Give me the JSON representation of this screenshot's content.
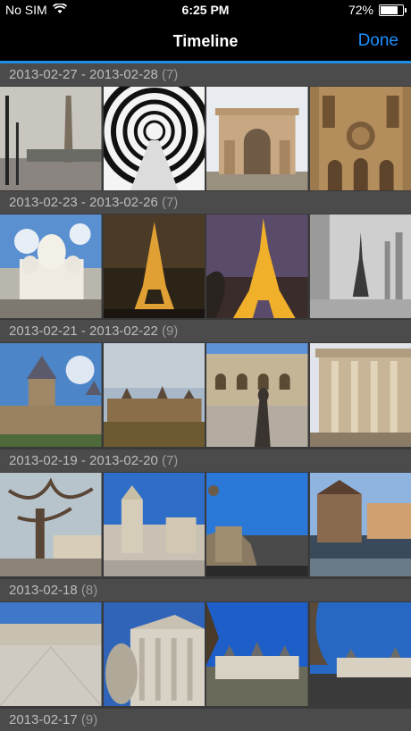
{
  "status_bar": {
    "carrier": "No SIM",
    "time": "6:25 PM",
    "battery": "72%",
    "battery_level": 0.72
  },
  "nav": {
    "title": "Timeline",
    "done_label": "Done"
  },
  "sections": [
    {
      "range": "2013-02-27 - 2013-02-28",
      "count": "(7)"
    },
    {
      "range": "2013-02-23 - 2013-02-26",
      "count": "(7)"
    },
    {
      "range": "2013-02-21 - 2013-02-22",
      "count": "(9)"
    },
    {
      "range": "2013-02-19 - 2013-02-20",
      "count": "(7)"
    },
    {
      "range": "2013-02-18",
      "count": "(8)"
    },
    {
      "range": "2013-02-17",
      "count": "(9)"
    }
  ],
  "colors": {
    "accent": "#1f8fe6",
    "done": "#1e90ff",
    "header_bg": "#4b4b4b",
    "header_text": "#bdbdbd"
  }
}
